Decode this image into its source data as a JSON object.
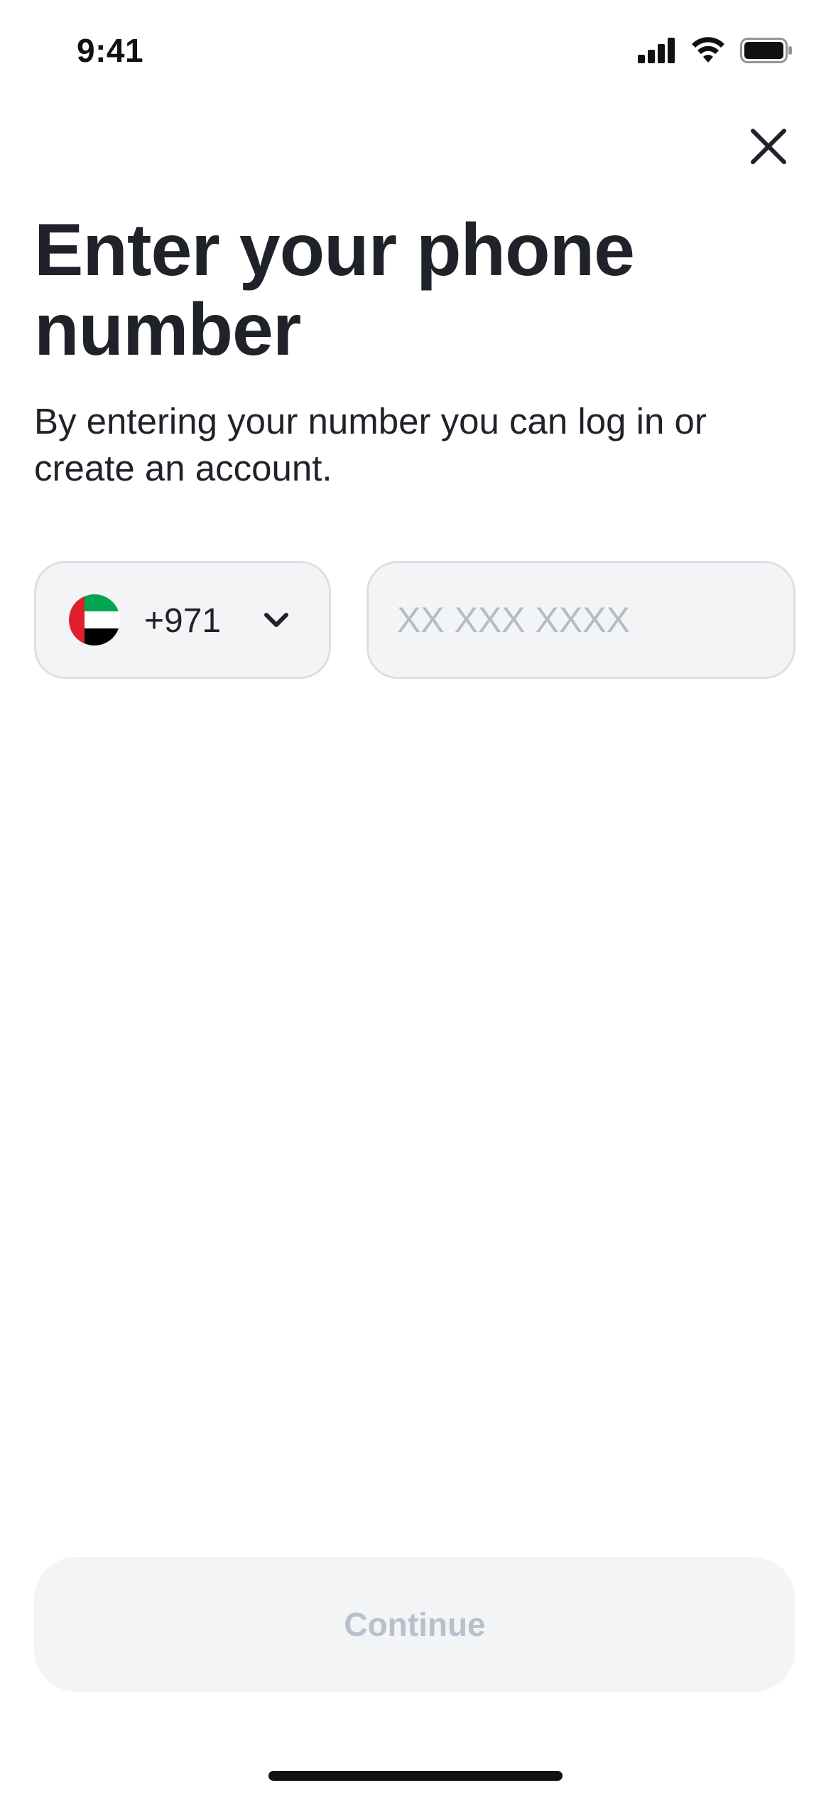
{
  "status_bar": {
    "time": "9:41",
    "icons": [
      "cellular-signal-icon",
      "wifi-icon",
      "battery-icon"
    ]
  },
  "header": {
    "close_icon": "close-icon"
  },
  "main": {
    "title": "Enter your phone number",
    "subtitle": "By entering your number you can log in or create an account.",
    "country_selector": {
      "flag": "uae-flag-icon",
      "dial_code": "+971",
      "chevron": "chevron-down-icon"
    },
    "phone_input": {
      "value": "",
      "placeholder": "XX XXX XXXX"
    }
  },
  "footer": {
    "continue_label": "Continue"
  },
  "colors": {
    "text": "#1f2329",
    "field_background": "#f3f4f6",
    "field_border": "#dbe0e6",
    "placeholder": "#b6bcc6",
    "disabled_text": "#b8c0cc",
    "flag_green": "#00a651",
    "flag_red": "#e01f2d",
    "flag_black": "#000000"
  }
}
